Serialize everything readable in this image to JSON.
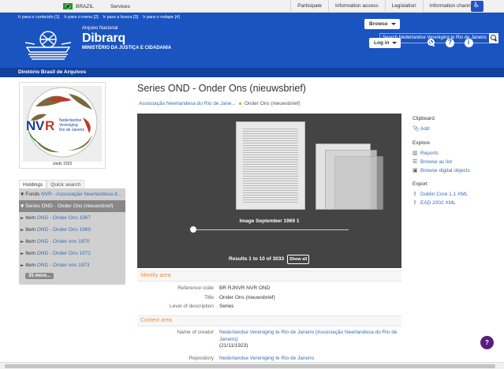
{
  "gov_bar": {
    "country": "BRAZIL",
    "services": "Services",
    "links": [
      "Participate",
      "Information access",
      "Legislation",
      "Information channels"
    ]
  },
  "header": {
    "skip_links": [
      "Ir para o conteúdo [1]",
      "Ir para o menu [2]",
      "Ir para a busca [3]",
      "Ir para o rodape [4]"
    ],
    "org_small": "Arquivo Nacional",
    "org_name": "Dibrarq",
    "ministry": "MINISTÉRIO DA JUSTIÇA E CIDADANIA",
    "browse_label": "Browse",
    "login_label": "Log in",
    "search_placeholder": "Search Nederlandse Vereniging te Rio de Janeiro",
    "brand_color": "#1a54c1"
  },
  "subheader": {
    "label": "Diretório Brasil de Arquivos"
  },
  "repo_logo": {
    "acronym": "NVR",
    "lines": [
      "Nederlandse",
      "Vereniging",
      "Rio de Janeiro"
    ],
    "year": "sinds 1923"
  },
  "sidebar": {
    "tabs": [
      "Holdings",
      "Quick search"
    ],
    "tree": [
      {
        "level": "Fonds",
        "title": "NVR - Associação Neerlandesa d...",
        "selected": false
      },
      {
        "level": "Series",
        "title": "OND - Onder Ons (nieuwsbrief)",
        "selected": true
      },
      {
        "level": "Item",
        "title": "OND - Onder Ons 1967",
        "selected": false
      },
      {
        "level": "Item",
        "title": "OND - Onder Ons 1969",
        "selected": false
      },
      {
        "level": "Item",
        "title": "OND - Onder ons 1970",
        "selected": false
      },
      {
        "level": "Item",
        "title": "OND - Onder Ons 1972",
        "selected": false
      },
      {
        "level": "Item",
        "title": "OND - Onder ons 1973",
        "selected": false
      }
    ],
    "more": "35 more..."
  },
  "main": {
    "title": "Series OND - Onder Ons (nieuwsbrief)",
    "breadcrumb": [
      "Associação Neerlandesa do Rio de Jane...",
      "Onder Ons (nieuwsbrief)"
    ],
    "viewer": {
      "caption": "Image September 1969 1",
      "results": "Results 1 to 10 of 3033",
      "show_all": "Show all"
    },
    "identity": {
      "heading": "Identity area",
      "fields": [
        {
          "label": "Reference code",
          "value": "BR RJNVR NVR OND"
        },
        {
          "label": "Title",
          "value": "Onder Ons (nieuwsbrief)"
        },
        {
          "label": "Level of description",
          "value": "Series"
        }
      ]
    },
    "context": {
      "heading": "Context area",
      "creator_label": "Name of creator",
      "creator_value": "Nederlandse Vereniging te Rio de Janeiro [Associação Neerlandesa do Rio de Janeiro]",
      "creator_dates": "(21/11/1923)",
      "repository_label": "Repository",
      "repository_value": "Nederlandse Vereniging te Rio de Janeiro"
    }
  },
  "right_sidebar": {
    "clipboard_title": "Clipboard",
    "add": "Add",
    "explore_title": "Explore",
    "explore_links": [
      "Reports",
      "Browse as list",
      "Browse digital objects"
    ],
    "export_title": "Export",
    "export_links": [
      "Dublin Core 1.1 XML",
      "EAD 2002 XML"
    ]
  },
  "help": {
    "icon_label": "?"
  }
}
